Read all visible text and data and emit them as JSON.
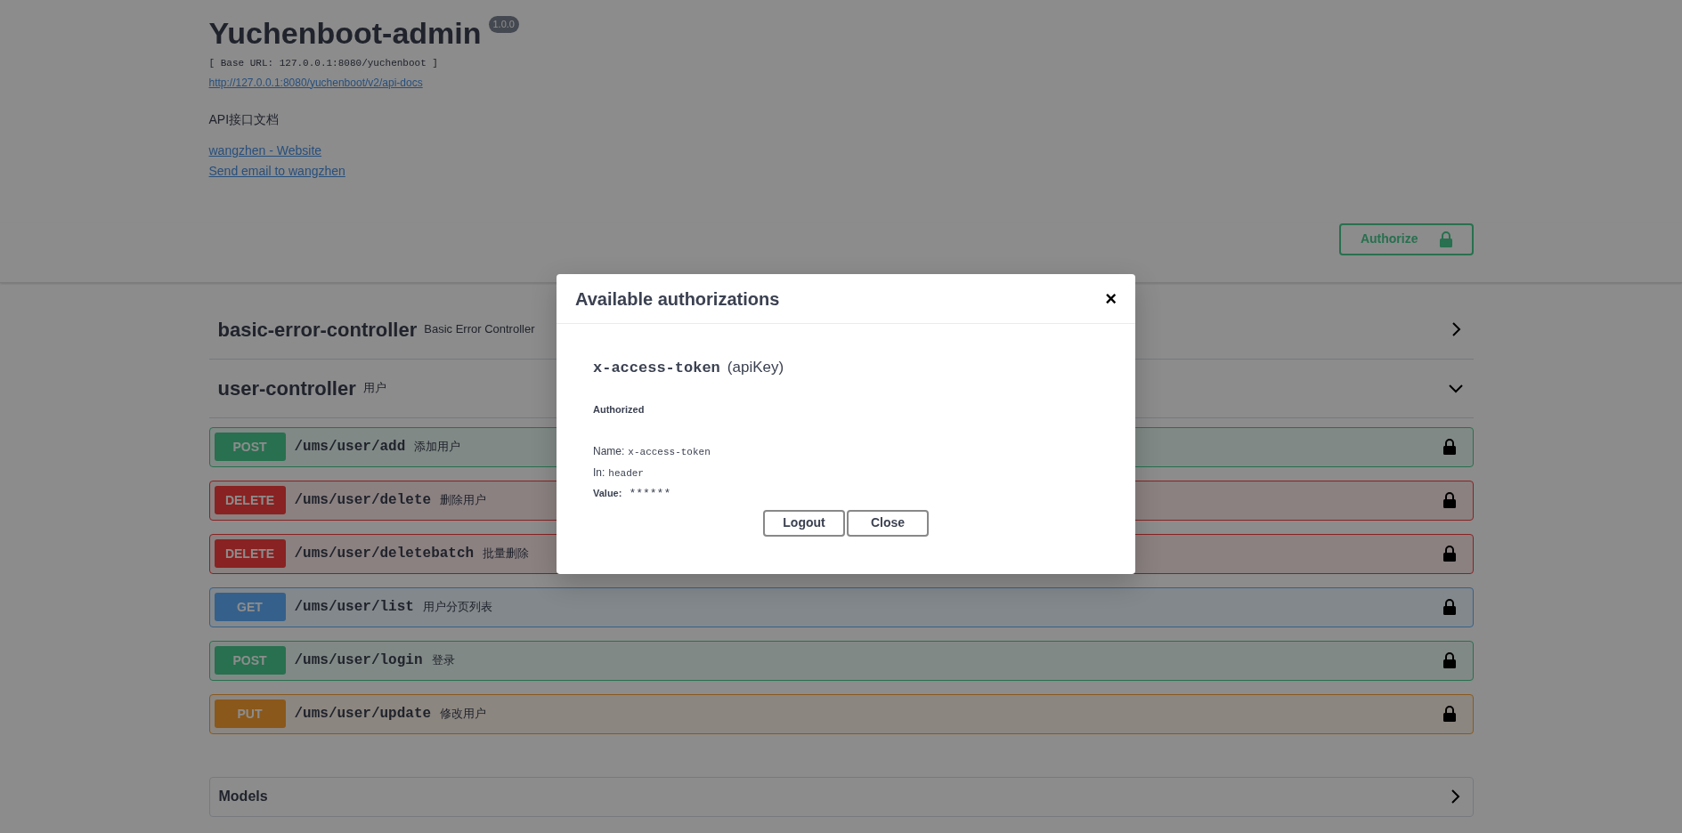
{
  "info": {
    "title": "Yuchenboot-admin",
    "version": "1.0.0",
    "base_url": "[ Base URL: 127.0.0.1:8080/yuchenboot ]",
    "spec_link": "http://127.0.0.1:8080/yuchenboot/v2/api-docs",
    "description": "API接口文档",
    "links": [
      "wangzhen - Website",
      "Send email to wangzhen"
    ]
  },
  "authorize_button": {
    "label": "Authorize"
  },
  "tags": [
    {
      "name": "basic-error-controller",
      "description": "Basic Error Controller",
      "expanded": false
    },
    {
      "name": "user-controller",
      "description": "用户",
      "expanded": true,
      "operations": [
        {
          "method": "POST",
          "path": "/ums/user/add",
          "summary": "添加用户"
        },
        {
          "method": "DELETE",
          "path": "/ums/user/delete",
          "summary": "删除用户"
        },
        {
          "method": "DELETE",
          "path": "/ums/user/deletebatch",
          "summary": "批量删除"
        },
        {
          "method": "GET",
          "path": "/ums/user/list",
          "summary": "用户分页列表"
        },
        {
          "method": "POST",
          "path": "/ums/user/login",
          "summary": "登录"
        },
        {
          "method": "PUT",
          "path": "/ums/user/update",
          "summary": "修改用户"
        }
      ]
    }
  ],
  "models": {
    "title": "Models",
    "expanded": false
  },
  "dialog": {
    "title": "Available authorizations",
    "close": "×",
    "scheme_name": "x-access-token",
    "scheme_type": "(apiKey)",
    "status": "Authorized",
    "name_label": "Name:",
    "name_value": "x-access-token",
    "in_label": "In:",
    "in_value": "header",
    "value_label": "Value:",
    "value": "******",
    "buttons": [
      "Logout",
      "Close"
    ]
  }
}
